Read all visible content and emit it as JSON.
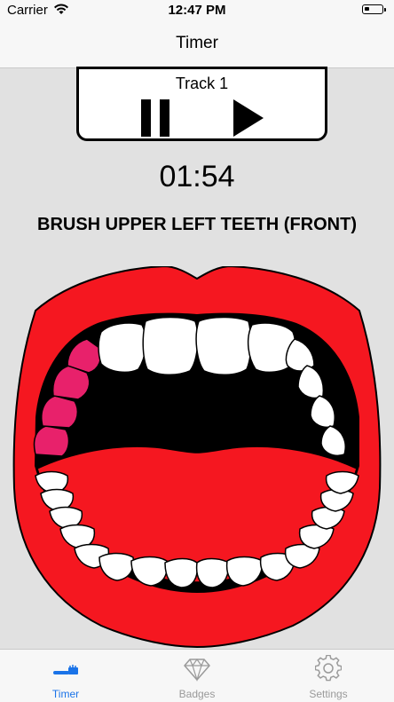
{
  "status_bar": {
    "carrier": "Carrier",
    "time": "12:47 PM"
  },
  "nav": {
    "title": "Timer"
  },
  "player": {
    "track_label": "Track 1"
  },
  "timer": {
    "time": "01:54"
  },
  "instruction": "BRUSH UPPER LEFT TEETH (FRONT)",
  "colors": {
    "lips": "#f51720",
    "highlight_teeth": "#e8216b",
    "tab_active": "#1a73e8",
    "tab_inactive": "#9a9a9a"
  },
  "tabs": [
    {
      "label": "Timer",
      "icon": "toothbrush-icon",
      "active": true
    },
    {
      "label": "Badges",
      "icon": "diamond-icon",
      "active": false
    },
    {
      "label": "Settings",
      "icon": "gear-icon",
      "active": false
    }
  ]
}
